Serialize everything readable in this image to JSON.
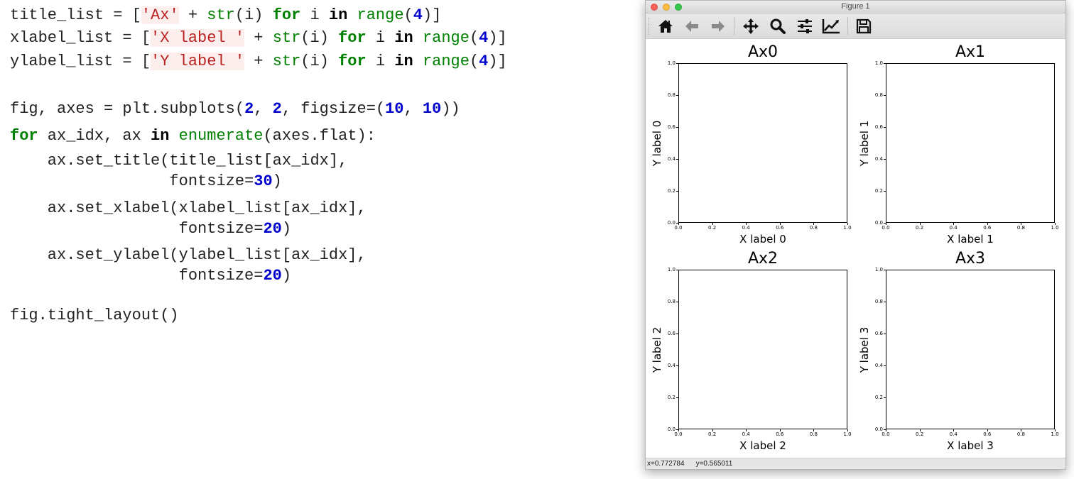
{
  "code": {
    "lines": [
      [
        {
          "t": "title_list = [",
          "c": ""
        },
        {
          "t": "'Ax'",
          "c": "str"
        },
        {
          "t": " + ",
          "c": ""
        },
        {
          "t": "str",
          "c": "bi"
        },
        {
          "t": "(i) ",
          "c": ""
        },
        {
          "t": "for",
          "c": "kw"
        },
        {
          "t": " i ",
          "c": ""
        },
        {
          "t": "in",
          "c": "kw2"
        },
        {
          "t": " ",
          "c": ""
        },
        {
          "t": "range",
          "c": "bi"
        },
        {
          "t": "(",
          "c": ""
        },
        {
          "t": "4",
          "c": "num"
        },
        {
          "t": ")]",
          "c": ""
        }
      ],
      [
        {
          "t": "xlabel_list = [",
          "c": ""
        },
        {
          "t": "'X label '",
          "c": "str"
        },
        {
          "t": " + ",
          "c": ""
        },
        {
          "t": "str",
          "c": "bi"
        },
        {
          "t": "(i) ",
          "c": ""
        },
        {
          "t": "for",
          "c": "kw"
        },
        {
          "t": " i ",
          "c": ""
        },
        {
          "t": "in",
          "c": "kw2"
        },
        {
          "t": " ",
          "c": ""
        },
        {
          "t": "range",
          "c": "bi"
        },
        {
          "t": "(",
          "c": ""
        },
        {
          "t": "4",
          "c": "num"
        },
        {
          "t": ")]",
          "c": ""
        }
      ],
      [
        {
          "t": "ylabel_list = [",
          "c": ""
        },
        {
          "t": "'Y label '",
          "c": "str"
        },
        {
          "t": " + ",
          "c": ""
        },
        {
          "t": "str",
          "c": "bi"
        },
        {
          "t": "(i) ",
          "c": ""
        },
        {
          "t": "for",
          "c": "kw"
        },
        {
          "t": " i ",
          "c": ""
        },
        {
          "t": "in",
          "c": "kw2"
        },
        {
          "t": " ",
          "c": ""
        },
        {
          "t": "range",
          "c": "bi"
        },
        {
          "t": "(",
          "c": ""
        },
        {
          "t": "4",
          "c": "num"
        },
        {
          "t": ")]",
          "c": ""
        }
      ],
      [
        {
          "t": "fig, axes = plt.subplots(",
          "c": ""
        },
        {
          "t": "2",
          "c": "num"
        },
        {
          "t": ", ",
          "c": ""
        },
        {
          "t": "2",
          "c": "num"
        },
        {
          "t": ", figsize=(",
          "c": ""
        },
        {
          "t": "10",
          "c": "num"
        },
        {
          "t": ", ",
          "c": ""
        },
        {
          "t": "10",
          "c": "num"
        },
        {
          "t": "))",
          "c": ""
        }
      ],
      [
        {
          "t": "for",
          "c": "kw"
        },
        {
          "t": " ax_idx, ax ",
          "c": ""
        },
        {
          "t": "in",
          "c": "kw2"
        },
        {
          "t": " ",
          "c": ""
        },
        {
          "t": "enumerate",
          "c": "bi"
        },
        {
          "t": "(axes.flat):",
          "c": ""
        }
      ],
      [
        {
          "t": "    ax.set_title(title_list[ax_idx],",
          "c": ""
        }
      ],
      [
        {
          "t": "                 fontsize=",
          "c": ""
        },
        {
          "t": "30",
          "c": "num"
        },
        {
          "t": ")",
          "c": ""
        }
      ],
      [
        {
          "t": "    ax.set_xlabel(xlabel_list[ax_idx],",
          "c": ""
        }
      ],
      [
        {
          "t": "                  fontsize=",
          "c": ""
        },
        {
          "t": "20",
          "c": "num"
        },
        {
          "t": ")",
          "c": ""
        }
      ],
      [
        {
          "t": "    ax.set_ylabel(ylabel_list[ax_idx],",
          "c": ""
        }
      ],
      [
        {
          "t": "                  fontsize=",
          "c": ""
        },
        {
          "t": "20",
          "c": "num"
        },
        {
          "t": ")",
          "c": ""
        }
      ],
      [
        {
          "t": "fig.tight_layout()",
          "c": ""
        }
      ]
    ]
  },
  "window": {
    "title": "Figure 1",
    "toolbar": {
      "items": [
        {
          "name": "home-icon",
          "glyph": "home"
        },
        {
          "name": "back-arrow-icon",
          "glyph": "back"
        },
        {
          "name": "forward-arrow-icon",
          "glyph": "forward"
        },
        {
          "name": "pan-icon",
          "glyph": "pan"
        },
        {
          "name": "zoom-icon",
          "glyph": "zoom"
        },
        {
          "name": "configure-subplots-icon",
          "glyph": "sliders"
        },
        {
          "name": "edit-axes-icon",
          "glyph": "chart"
        },
        {
          "name": "save-icon",
          "glyph": "save"
        }
      ]
    },
    "status": {
      "x": "x=0.772784",
      "y": "y=0.565011"
    }
  },
  "colors": {
    "keyword": "#008000",
    "number": "#0000cc",
    "string_bg": "#fdeeee",
    "close": "#fc605c",
    "minimize": "#fdbc40",
    "maximize": "#34c84a"
  },
  "chart_data": [
    {
      "type": "scatter",
      "title": "Ax0",
      "xlabel": "X label 0",
      "ylabel": "Y label 0",
      "xlim": [
        0,
        1
      ],
      "ylim": [
        0,
        1
      ],
      "xticks": [
        "0.0",
        "0.2",
        "0.4",
        "0.6",
        "0.8",
        "1.0"
      ],
      "yticks": [
        "0.0",
        "0.2",
        "0.4",
        "0.6",
        "0.8",
        "1.0"
      ],
      "series": []
    },
    {
      "type": "scatter",
      "title": "Ax1",
      "xlabel": "X label 1",
      "ylabel": "Y label 1",
      "xlim": [
        0,
        1
      ],
      "ylim": [
        0,
        1
      ],
      "xticks": [
        "0.0",
        "0.2",
        "0.4",
        "0.6",
        "0.8",
        "1.0"
      ],
      "yticks": [
        "0.0",
        "0.2",
        "0.4",
        "0.6",
        "0.8",
        "1.0"
      ],
      "series": []
    },
    {
      "type": "scatter",
      "title": "Ax2",
      "xlabel": "X label 2",
      "ylabel": "Y label 2",
      "xlim": [
        0,
        1
      ],
      "ylim": [
        0,
        1
      ],
      "xticks": [
        "0.0",
        "0.2",
        "0.4",
        "0.6",
        "0.8",
        "1.0"
      ],
      "yticks": [
        "0.0",
        "0.2",
        "0.4",
        "0.6",
        "0.8",
        "1.0"
      ],
      "series": []
    },
    {
      "type": "scatter",
      "title": "Ax3",
      "xlabel": "X label 3",
      "ylabel": "Y label 3",
      "xlim": [
        0,
        1
      ],
      "ylim": [
        0,
        1
      ],
      "xticks": [
        "0.0",
        "0.2",
        "0.4",
        "0.6",
        "0.8",
        "1.0"
      ],
      "yticks": [
        "0.0",
        "0.2",
        "0.4",
        "0.6",
        "0.8",
        "1.0"
      ],
      "series": []
    }
  ]
}
